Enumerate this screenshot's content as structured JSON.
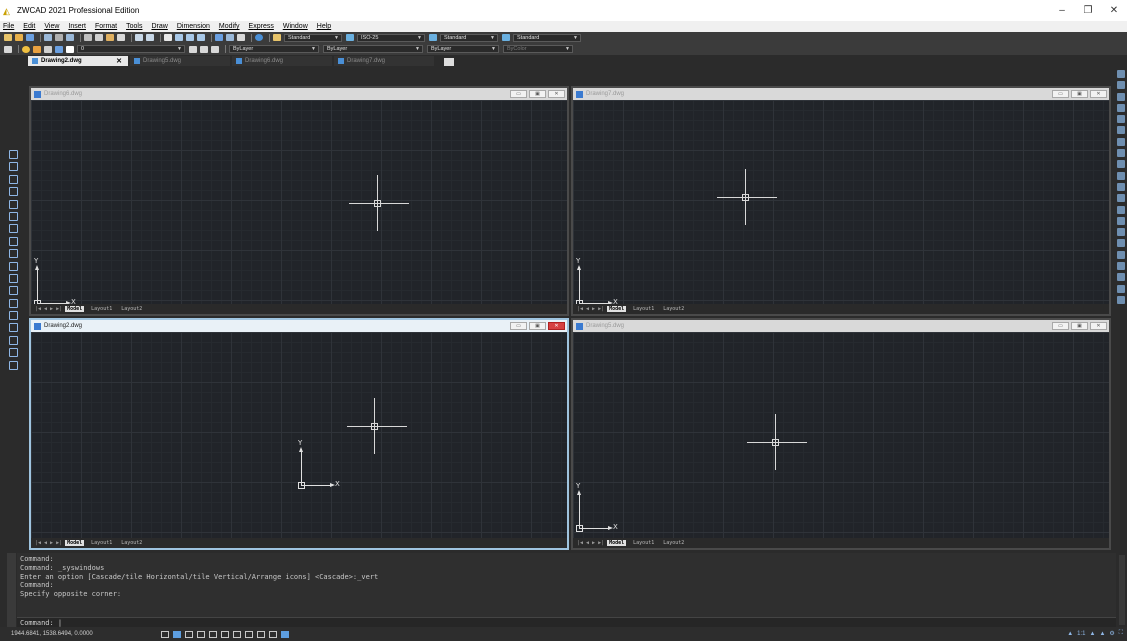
{
  "title": "ZWCAD 2021 Professional Edition",
  "window_controls": [
    "–",
    "❐",
    "✕"
  ],
  "menu": [
    "File",
    "Edit",
    "View",
    "Insert",
    "Format",
    "Tools",
    "Draw",
    "Dimension",
    "Modify",
    "Express",
    "Window",
    "Help"
  ],
  "toolbar1": {
    "text_style": "Standard",
    "dim_style": "ISO-25",
    "table_style": "Standard",
    "mleader_style": "Standard"
  },
  "toolbar2": {
    "layer": "0",
    "color": "ByLayer",
    "linetype": "ByLayer",
    "lineweight": "ByLayer",
    "plotstyle": "ByColor"
  },
  "tabs": [
    {
      "label": "Drawing2.dwg",
      "active": true
    },
    {
      "label": "Drawing5.dwg",
      "active": false
    },
    {
      "label": "Drawing6.dwg",
      "active": false
    },
    {
      "label": "Drawing7.dwg",
      "active": false
    }
  ],
  "windows": {
    "tl": {
      "title": "Drawing6.dwg"
    },
    "tr": {
      "title": "Drawing7.dwg"
    },
    "bl": {
      "title": "Drawing2.dwg"
    },
    "br": {
      "title": "Drawing5.dwg"
    }
  },
  "layout_tabs": {
    "model": "Model",
    "layout1": "Layout1",
    "layout2": "Layout2",
    "nav": "|◀ ◀ ▶ ▶|"
  },
  "axis": {
    "x": "X",
    "y": "Y"
  },
  "command_history": [
    "Command:",
    "Command: _syswindows",
    "Enter an option [Cascade/tile Horizontal/tile Vertical/Arrange icons] <Cascade>:_vert",
    "Command:",
    "Specify opposite corner:"
  ],
  "command_prompt": "Command: |",
  "coordinates": "1944.6841, 1538.6494, 0.0000",
  "annotation_scale": "1:1"
}
